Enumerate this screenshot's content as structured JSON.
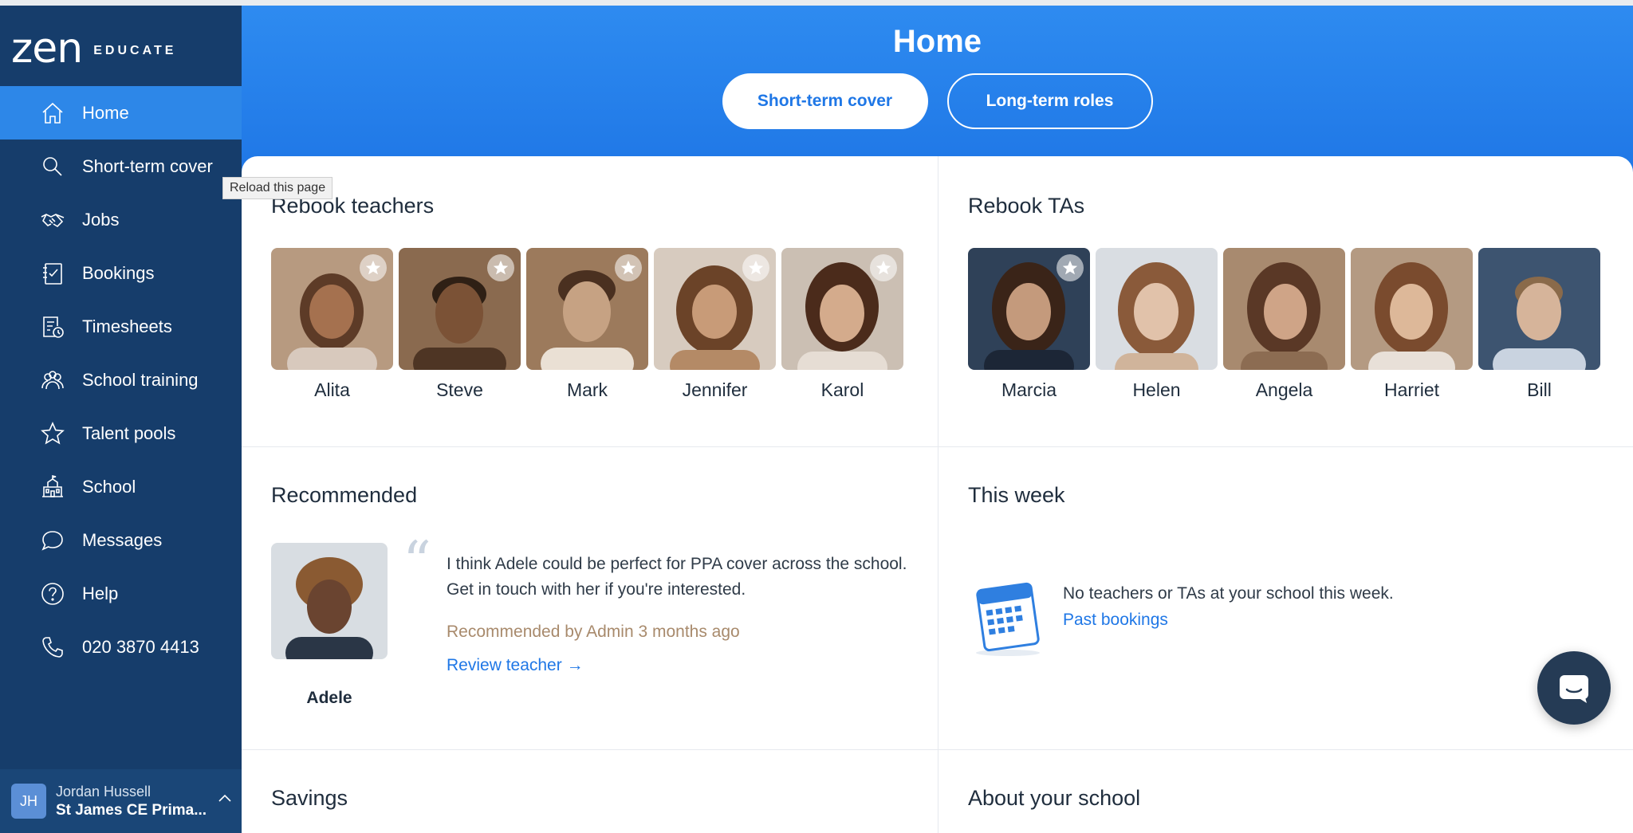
{
  "brand": {
    "logo_main": "zen",
    "logo_sub": "EDUCATE"
  },
  "tooltip": "Reload this page",
  "sidebar": {
    "items": [
      {
        "label": "Home",
        "icon": "home-icon",
        "active": true
      },
      {
        "label": "Short-term cover",
        "icon": "search-icon"
      },
      {
        "label": "Jobs",
        "icon": "handshake-icon"
      },
      {
        "label": "Bookings",
        "icon": "bookings-icon"
      },
      {
        "label": "Timesheets",
        "icon": "timesheet-icon"
      },
      {
        "label": "School training",
        "icon": "training-icon"
      },
      {
        "label": "Talent pools",
        "icon": "star-icon"
      },
      {
        "label": "School",
        "icon": "school-icon"
      },
      {
        "label": "Messages",
        "icon": "chat-icon"
      },
      {
        "label": "Help",
        "icon": "help-icon"
      },
      {
        "label": "020 3870 4413",
        "icon": "phone-icon"
      }
    ],
    "user": {
      "initials": "JH",
      "name": "Jordan Hussell",
      "school": "St James CE Prima..."
    }
  },
  "header": {
    "title": "Home",
    "tabs": [
      {
        "label": "Short-term cover",
        "selected": true
      },
      {
        "label": "Long-term roles",
        "selected": false
      }
    ]
  },
  "rebook_teachers": {
    "title": "Rebook teachers",
    "people": [
      {
        "name": "Alita",
        "starred": true
      },
      {
        "name": "Steve",
        "starred": true
      },
      {
        "name": "Mark",
        "starred": true
      },
      {
        "name": "Jennifer",
        "starred": true
      },
      {
        "name": "Karol",
        "starred": true
      }
    ]
  },
  "rebook_tas": {
    "title": "Rebook TAs",
    "people": [
      {
        "name": "Marcia",
        "starred": true
      },
      {
        "name": "Helen",
        "starred": false
      },
      {
        "name": "Angela",
        "starred": false
      },
      {
        "name": "Harriet",
        "starred": false
      },
      {
        "name": "Bill",
        "starred": false
      }
    ]
  },
  "recommended": {
    "title": "Recommended",
    "name": "Adele",
    "quote": "I think Adele could be perfect for PPA cover across the school. Get in touch with her if you're interested.",
    "meta": "Recommended by Admin 3 months ago",
    "link": "Review teacher →"
  },
  "this_week": {
    "title": "This week",
    "message": "No teachers or TAs at your school this week.",
    "link": "Past bookings"
  },
  "savings": {
    "title": "Savings"
  },
  "about": {
    "title": "About your school"
  },
  "colors": {
    "sidebar": "#163d6b",
    "accent": "#2d87e8",
    "header": "#2e8bf0",
    "link": "#1f77e6"
  }
}
